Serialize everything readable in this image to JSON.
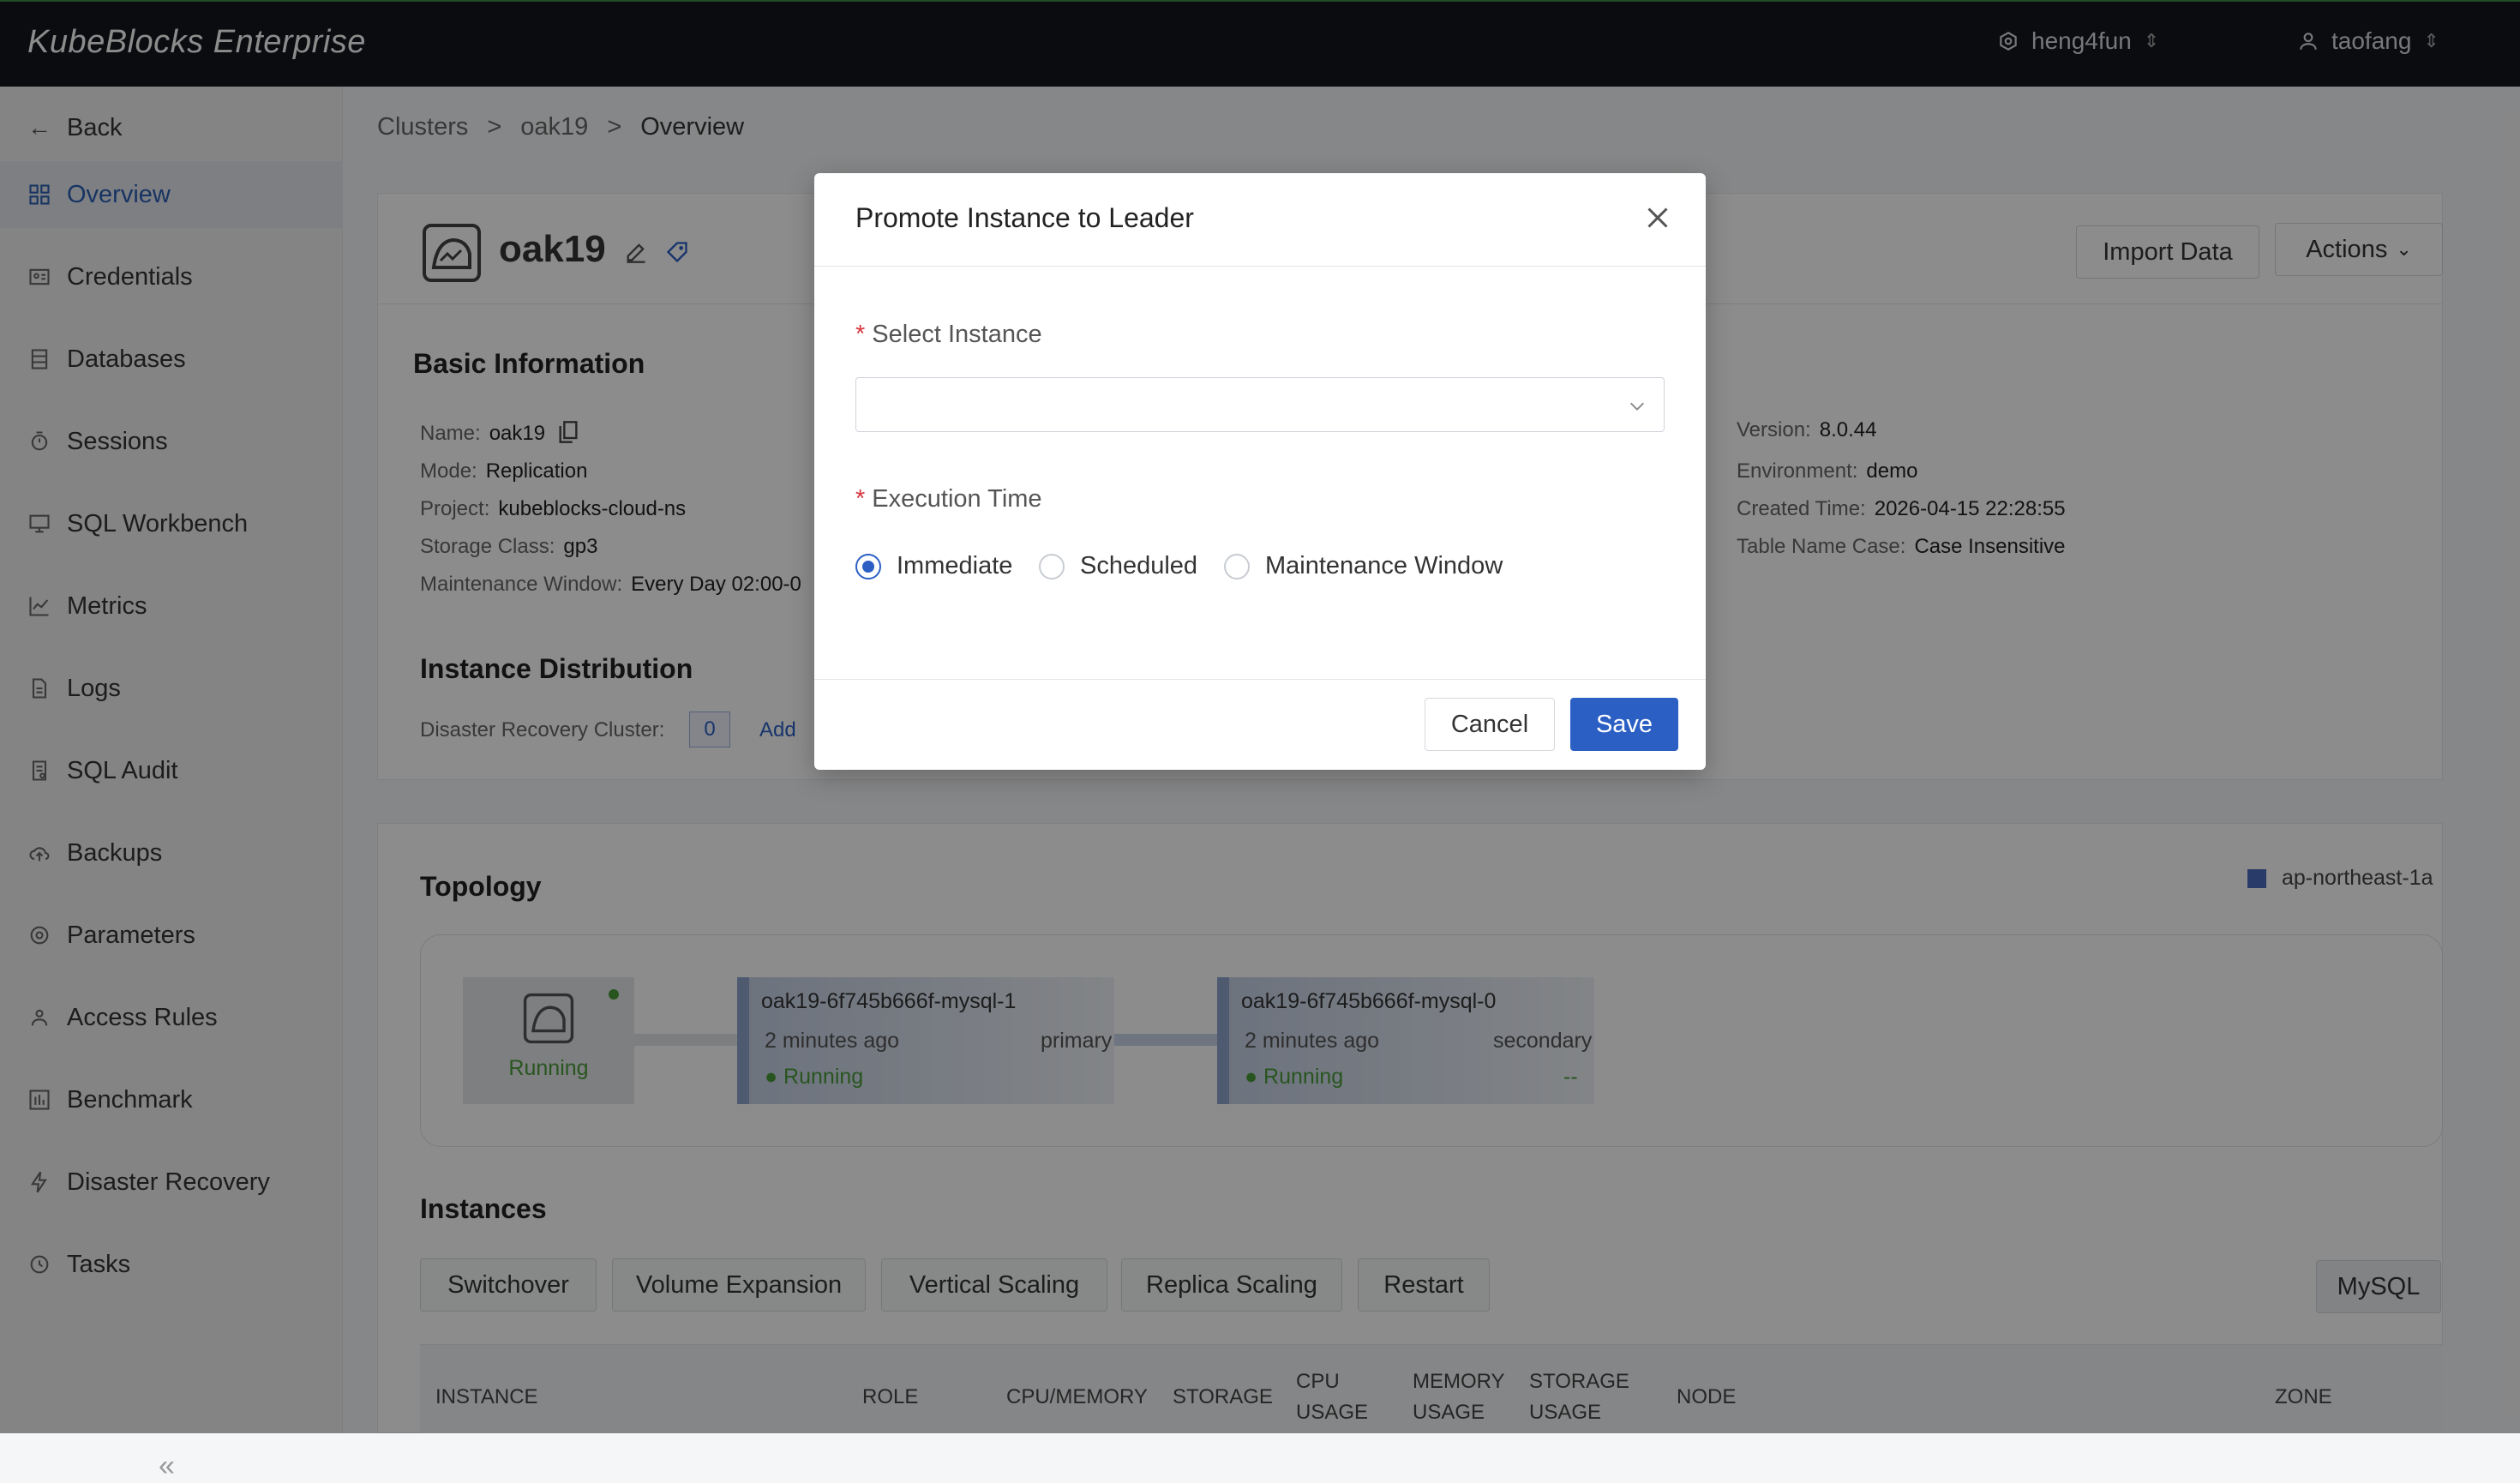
{
  "app": {
    "brand": "KubeBlocks Enterprise",
    "org": "heng4fun",
    "user": "taofang"
  },
  "sidebar": {
    "back": "Back",
    "items": [
      {
        "label": "Overview",
        "icon": "grid-icon",
        "active": true
      },
      {
        "label": "Credentials",
        "icon": "id-card-icon"
      },
      {
        "label": "Databases",
        "icon": "database-icon"
      },
      {
        "label": "Sessions",
        "icon": "timer-icon"
      },
      {
        "label": "SQL Workbench",
        "icon": "monitor-icon"
      },
      {
        "label": "Metrics",
        "icon": "chart-icon"
      },
      {
        "label": "Logs",
        "icon": "file-icon"
      },
      {
        "label": "SQL Audit",
        "icon": "audit-icon"
      },
      {
        "label": "Backups",
        "icon": "cloud-upload-icon"
      },
      {
        "label": "Parameters",
        "icon": "gear-icon"
      },
      {
        "label": "Access Rules",
        "icon": "users-icon"
      },
      {
        "label": "Benchmark",
        "icon": "benchmark-icon"
      },
      {
        "label": "Disaster Recovery",
        "icon": "bolt-icon"
      },
      {
        "label": "Tasks",
        "icon": "clock-icon"
      }
    ],
    "collapse": "«"
  },
  "breadcrumb": [
    "Clusters",
    "oak19",
    "Overview"
  ],
  "cluster": {
    "name": "oak19",
    "import_label": "Import Data",
    "actions_label": "Actions",
    "basic_title": "Basic Information",
    "name_label": "Name:",
    "name_value": "oak19",
    "mode_label": "Mode:",
    "mode_value": "Replication",
    "project_label": "Project:",
    "project_value": "kubeblocks-cloud-ns",
    "storage_label": "Storage Class:",
    "storage_value": "gp3",
    "mw_label": "Maintenance Window:",
    "mw_value": "Every Day 02:00-0",
    "version_label": "Version:",
    "version_value": "8.0.44",
    "env_label": "Environment:",
    "env_value": "demo",
    "created_label": "Created Time:",
    "created_value": "2026-04-15 22:28:55",
    "tnc_label": "Table Name Case:",
    "tnc_value": "Case Insensitive",
    "dist_title": "Instance Distribution",
    "dr_label": "Disaster Recovery Cluster:",
    "dr_value": "0",
    "dr_add": "Add"
  },
  "topology": {
    "title": "Topology",
    "zone": "ap-northeast-1a",
    "root_status": "Running",
    "pods": [
      {
        "name": "oak19-6f745b666f-mysql-1",
        "time": "2 minutes ago",
        "role": "primary",
        "status": "Running",
        "extra": ""
      },
      {
        "name": "oak19-6f745b666f-mysql-0",
        "time": "2 minutes ago",
        "role": "secondary",
        "status": "Running",
        "extra": "--"
      }
    ]
  },
  "instances": {
    "title": "Instances",
    "buttons": [
      "Switchover",
      "Volume Expansion",
      "Vertical Scaling",
      "Replica Scaling",
      "Restart"
    ],
    "engine": "MySQL",
    "columns": [
      "INSTANCE",
      "ROLE",
      "CPU/MEMORY",
      "STORAGE",
      "CPU USAGE",
      "MEMORY USAGE",
      "STORAGE USAGE",
      "NODE",
      "ZONE"
    ]
  },
  "modal": {
    "title": "Promote Instance to Leader",
    "select_label": "Select Instance",
    "select_value": "",
    "time_label": "Execution Time",
    "options": [
      "Immediate",
      "Scheduled",
      "Maintenance Window"
    ],
    "selected": "Immediate",
    "cancel": "Cancel",
    "save": "Save"
  }
}
